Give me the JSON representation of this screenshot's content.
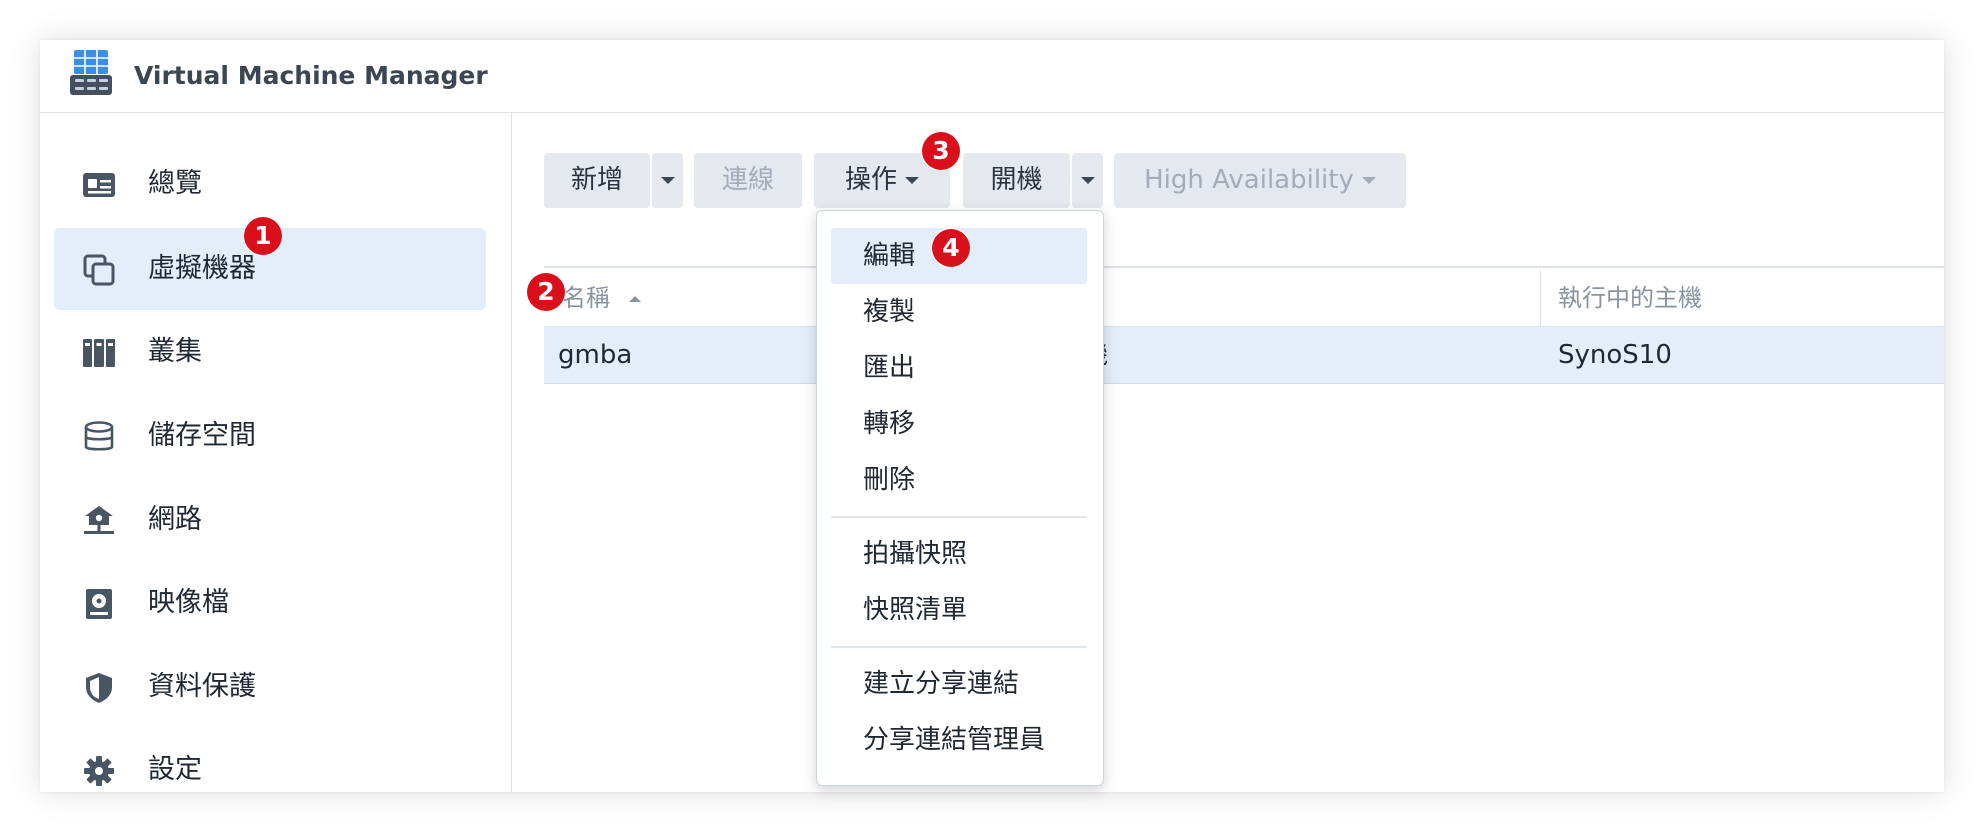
{
  "app": {
    "title": "Virtual Machine Manager",
    "icon": "vmm-app-icon"
  },
  "sidebar": {
    "items": [
      {
        "label": "總覽",
        "icon": "overview-icon",
        "active": false
      },
      {
        "label": "虛擬機器",
        "icon": "virtual-machine-icon",
        "active": true
      },
      {
        "label": "叢集",
        "icon": "cluster-icon",
        "active": false
      },
      {
        "label": "儲存空間",
        "icon": "storage-icon",
        "active": false
      },
      {
        "label": "網路",
        "icon": "network-icon",
        "active": false
      },
      {
        "label": "映像檔",
        "icon": "image-icon",
        "active": false
      },
      {
        "label": "資料保護",
        "icon": "data-protection-icon",
        "active": false
      },
      {
        "label": "設定",
        "icon": "gear-icon",
        "active": false
      }
    ]
  },
  "toolbar": {
    "create_label": "新增",
    "connect_label": "連線",
    "action_label": "操作",
    "power_on_label": "開機",
    "ha_label": "High Availability"
  },
  "table": {
    "columns": [
      "名稱",
      "執行中的主機"
    ],
    "rows": [
      {
        "name": "gmba",
        "status_partial": "機",
        "host": "SynoS10"
      }
    ]
  },
  "action_menu": {
    "groups": [
      [
        "編輯",
        "複製",
        "匯出",
        "轉移",
        "刪除"
      ],
      [
        "拍攝快照",
        "快照清單"
      ],
      [
        "建立分享連結",
        "分享連結管理員"
      ]
    ]
  },
  "annotations": [
    "1",
    "2",
    "3",
    "4"
  ],
  "colors": {
    "accent_active_bg": "#e4edfa",
    "button_bg": "#e4e9ef",
    "badge_red": "#d9101b",
    "text_primary": "#1f2833",
    "text_muted": "#8a94a0"
  }
}
